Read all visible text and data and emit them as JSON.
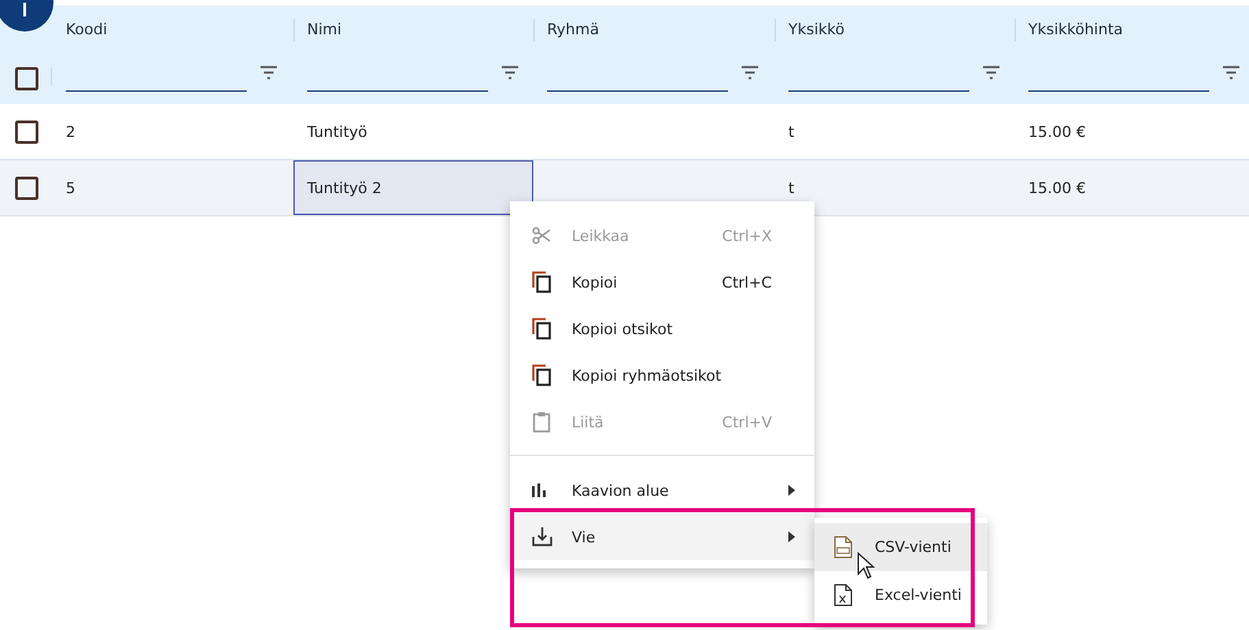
{
  "table": {
    "header_checkbox": {
      "checked": false
    },
    "columns": [
      {
        "title": "Koodi"
      },
      {
        "title": "Nimi"
      },
      {
        "title": "Ryhmä"
      },
      {
        "title": "Yksikkö"
      },
      {
        "title": "Yksikköhinta"
      }
    ],
    "rows": [
      {
        "checked": false,
        "highlighted": false,
        "cells": [
          {
            "text": "2",
            "focused": false
          },
          {
            "text": "Tuntityö",
            "focused": false
          },
          {
            "focused": false
          },
          {
            "text": "t",
            "focused": false
          },
          {
            "text": "15.00 €",
            "focused": false
          }
        ]
      },
      {
        "checked": false,
        "highlighted": true,
        "cells": [
          {
            "text": "5",
            "focused": false
          },
          {
            "text": "Tuntityö 2",
            "focused": true
          },
          {
            "focused": false
          },
          {
            "text": "t",
            "focused": false
          },
          {
            "text": "15.00 €",
            "focused": false
          }
        ]
      }
    ]
  },
  "context_menu": {
    "items": [
      {
        "kind": "cut",
        "label": "Leikkaa",
        "shortcut": "Ctrl+X",
        "disabled": true,
        "submenu": false,
        "highlighted": false
      },
      {
        "kind": "copy",
        "label": "Kopioi",
        "shortcut": "Ctrl+C",
        "disabled": false,
        "submenu": false,
        "highlighted": false
      },
      {
        "kind": "copy",
        "label": "Kopioi otsikot",
        "disabled": false,
        "submenu": false,
        "highlighted": false
      },
      {
        "kind": "copy",
        "label": "Kopioi ryhmäotsikot",
        "disabled": false,
        "submenu": false,
        "highlighted": false
      },
      {
        "kind": "paste",
        "label": "Liitä",
        "shortcut": "Ctrl+V",
        "disabled": true,
        "submenu": false,
        "highlighted": false
      },
      {
        "kind": "divider"
      },
      {
        "kind": "chart",
        "label": "Kaavion alue",
        "disabled": false,
        "submenu": true,
        "highlighted": false
      },
      {
        "kind": "export",
        "label": "Vie",
        "disabled": false,
        "submenu": true,
        "highlighted": true
      }
    ]
  },
  "submenu": {
    "items": [
      {
        "kind": "csv",
        "label": "CSV-vienti",
        "highlighted": true
      },
      {
        "kind": "excel",
        "label": "Excel-vienti",
        "highlighted": false
      }
    ]
  },
  "highlight_frame": {
    "shown": true
  }
}
